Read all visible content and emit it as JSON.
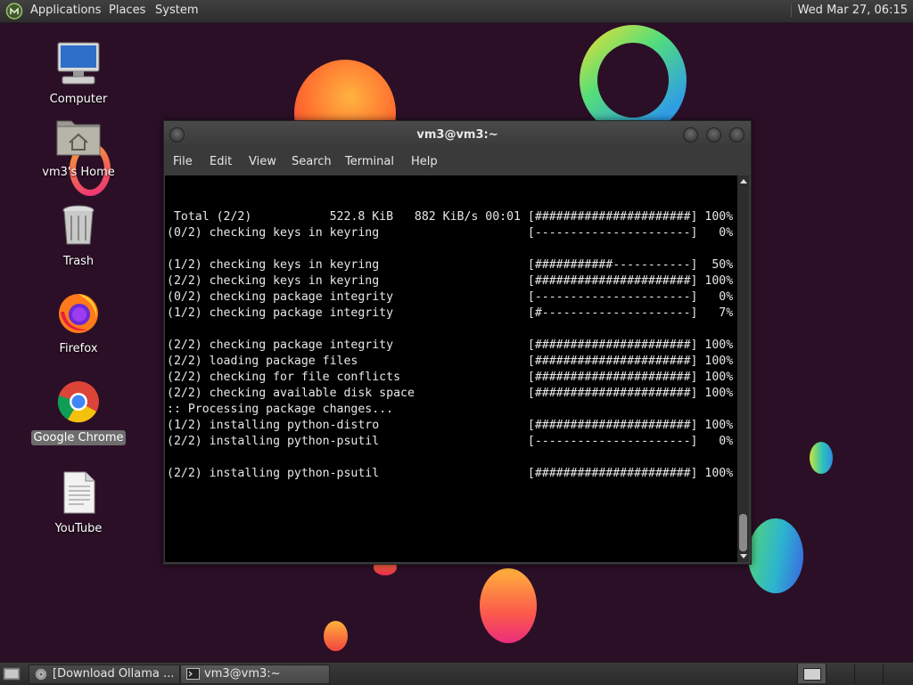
{
  "top_panel": {
    "menus": [
      "Applications",
      "Places",
      "System"
    ],
    "clock": "Wed Mar 27, 06:15"
  },
  "desktop_icons": [
    {
      "label": "Computer",
      "icon": "computer-icon"
    },
    {
      "label": "vm3's Home",
      "icon": "home-folder-icon"
    },
    {
      "label": "Trash",
      "icon": "trash-icon"
    },
    {
      "label": "Firefox",
      "icon": "firefox-icon"
    },
    {
      "label": "Google Chrome",
      "icon": "chrome-icon"
    },
    {
      "label": "YouTube",
      "icon": "document-icon"
    }
  ],
  "terminal": {
    "title": "vm3@vm3:~",
    "menu": [
      "File",
      "Edit",
      "View",
      "Search",
      "Terminal",
      "Help"
    ],
    "lines": [
      " Total (2/2)           522.8 KiB   882 KiB/s 00:01 [######################] 100%",
      "(0/2) checking keys in keyring                     [----------------------]   0%",
      "",
      "(1/2) checking keys in keyring                     [###########-----------]  50%",
      "(2/2) checking keys in keyring                     [######################] 100%",
      "(0/2) checking package integrity                   [----------------------]   0%",
      "(1/2) checking package integrity                   [#---------------------]   7%",
      "",
      "(2/2) checking package integrity                   [######################] 100%",
      "(2/2) loading package files                        [######################] 100%",
      "(2/2) checking for file conflicts                  [######################] 100%",
      "(2/2) checking available disk space                [######################] 100%",
      ":: Processing package changes...",
      "(1/2) installing python-distro                     [######################] 100%",
      "(2/2) installing python-psutil                     [----------------------]   0%",
      "",
      "(2/2) installing python-psutil                     [######################] 100%"
    ]
  },
  "taskbar": {
    "tasks": [
      {
        "label": "[Download Ollama ...",
        "icon": "chrome-icon"
      },
      {
        "label": "vm3@vm3:~",
        "icon": "terminal-icon"
      }
    ]
  }
}
